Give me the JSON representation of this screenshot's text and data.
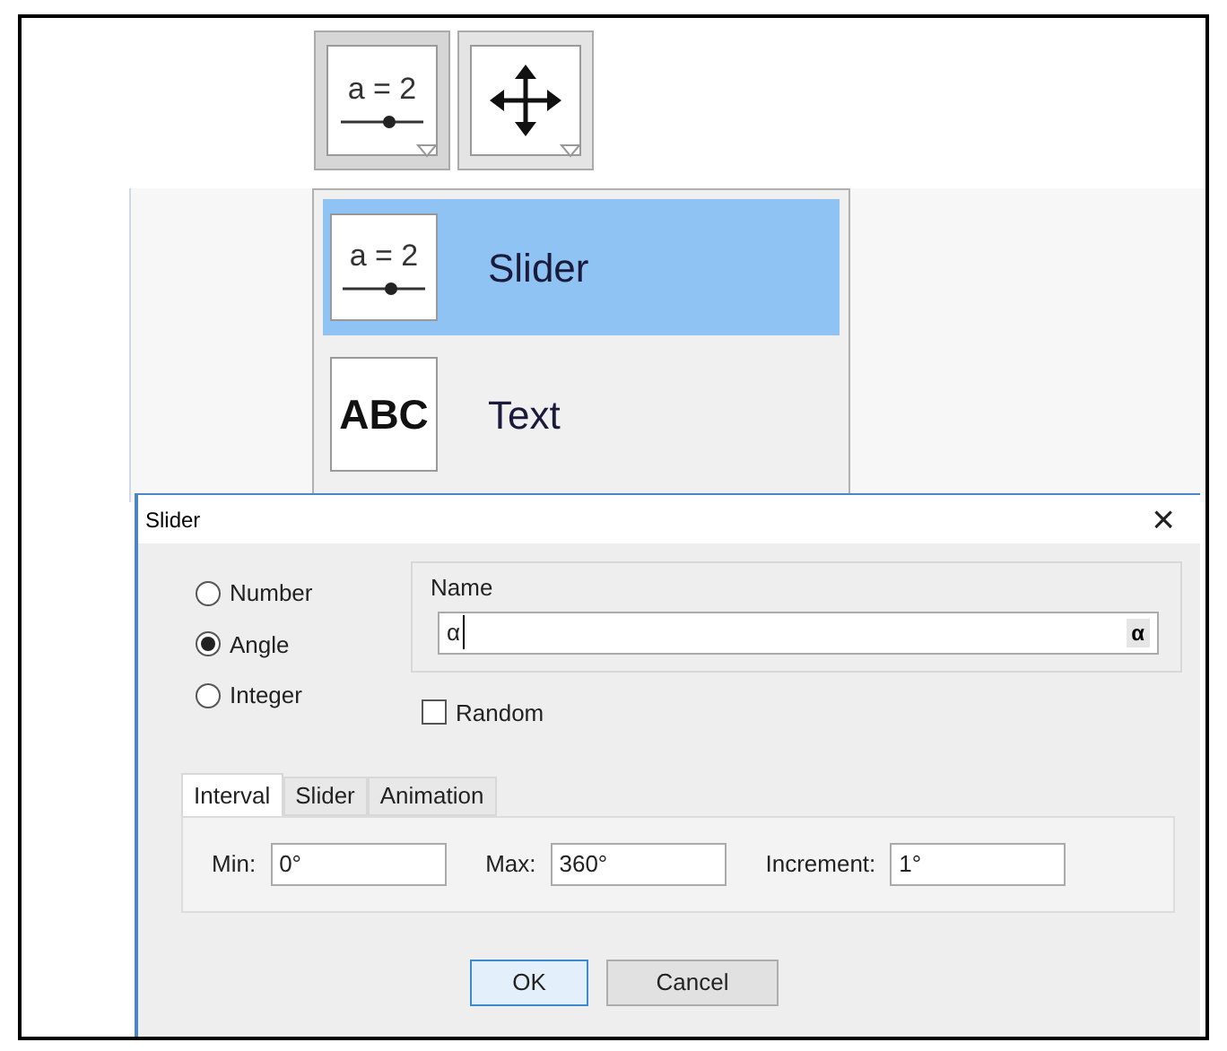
{
  "toolbar": [
    {
      "kind": "slider",
      "label": "a = 2",
      "selected": true
    },
    {
      "kind": "move",
      "selected": false
    }
  ],
  "menu": {
    "items": [
      {
        "kind": "slider",
        "icon_text": "a = 2",
        "label": "Slider",
        "selected": true
      },
      {
        "kind": "text",
        "icon_text": "ABC",
        "label": "Text",
        "selected": false
      }
    ]
  },
  "dialog": {
    "title": "Slider",
    "close": "×",
    "types": [
      {
        "label": "Number",
        "selected": false
      },
      {
        "label": "Angle",
        "selected": true
      },
      {
        "label": "Integer",
        "selected": false
      }
    ],
    "name": {
      "label": "Name",
      "value": "α",
      "symbol_button": "α"
    },
    "random": {
      "label": "Random",
      "checked": false
    },
    "tabs": [
      {
        "label": "Interval",
        "selected": true
      },
      {
        "label": "Slider",
        "selected": false
      },
      {
        "label": "Animation",
        "selected": false
      }
    ],
    "fields": [
      {
        "label": "Min:",
        "value": "0°"
      },
      {
        "label": "Max:",
        "value": "360°"
      },
      {
        "label": "Increment:",
        "value": "1°"
      }
    ],
    "buttons": [
      {
        "label": "OK",
        "default": true
      },
      {
        "label": "Cancel",
        "default": false
      }
    ]
  }
}
